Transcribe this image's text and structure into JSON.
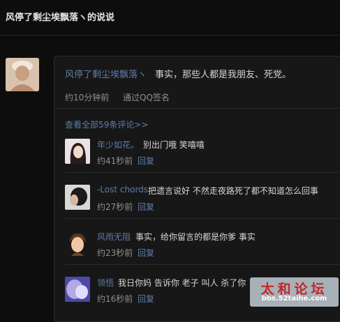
{
  "page": {
    "title": "风停了剩尘埃飘落ヽ的说说"
  },
  "post": {
    "author": "风停了剩尘埃飘落ヽ",
    "text": "事实，那些人都是我朋友、死党。",
    "time": "约10分钟前",
    "source": "通过QQ签名",
    "view_all": "查看全部59条评论>>"
  },
  "comments": [
    {
      "author": "年少如花。",
      "text": "别出门哦 笑嘻嘻",
      "time": "约41秒前",
      "reply": "回复"
    },
    {
      "author": "-Lost chords",
      "text": "把遗言说好 不然走夜路死了都不知道怎么回事",
      "time": "约27秒前",
      "reply": "回复"
    },
    {
      "author": "风雨无阻",
      "text": "事实，给你留言的都是你爹 事实",
      "time": "约23秒前",
      "reply": "回复"
    },
    {
      "author": "领悟",
      "text": "我日你妈 告诉你 老子 叫人 杀了你",
      "time": "约16秒前",
      "reply": "回复"
    }
  ],
  "watermark": {
    "title": "太和论坛",
    "url": "bbs.52taihe.com"
  },
  "colors": {
    "background": "#0d0d0d",
    "card": "#171717",
    "link": "#5e7ea8",
    "text": "#d6d6d6",
    "muted": "#8f8f8f"
  }
}
